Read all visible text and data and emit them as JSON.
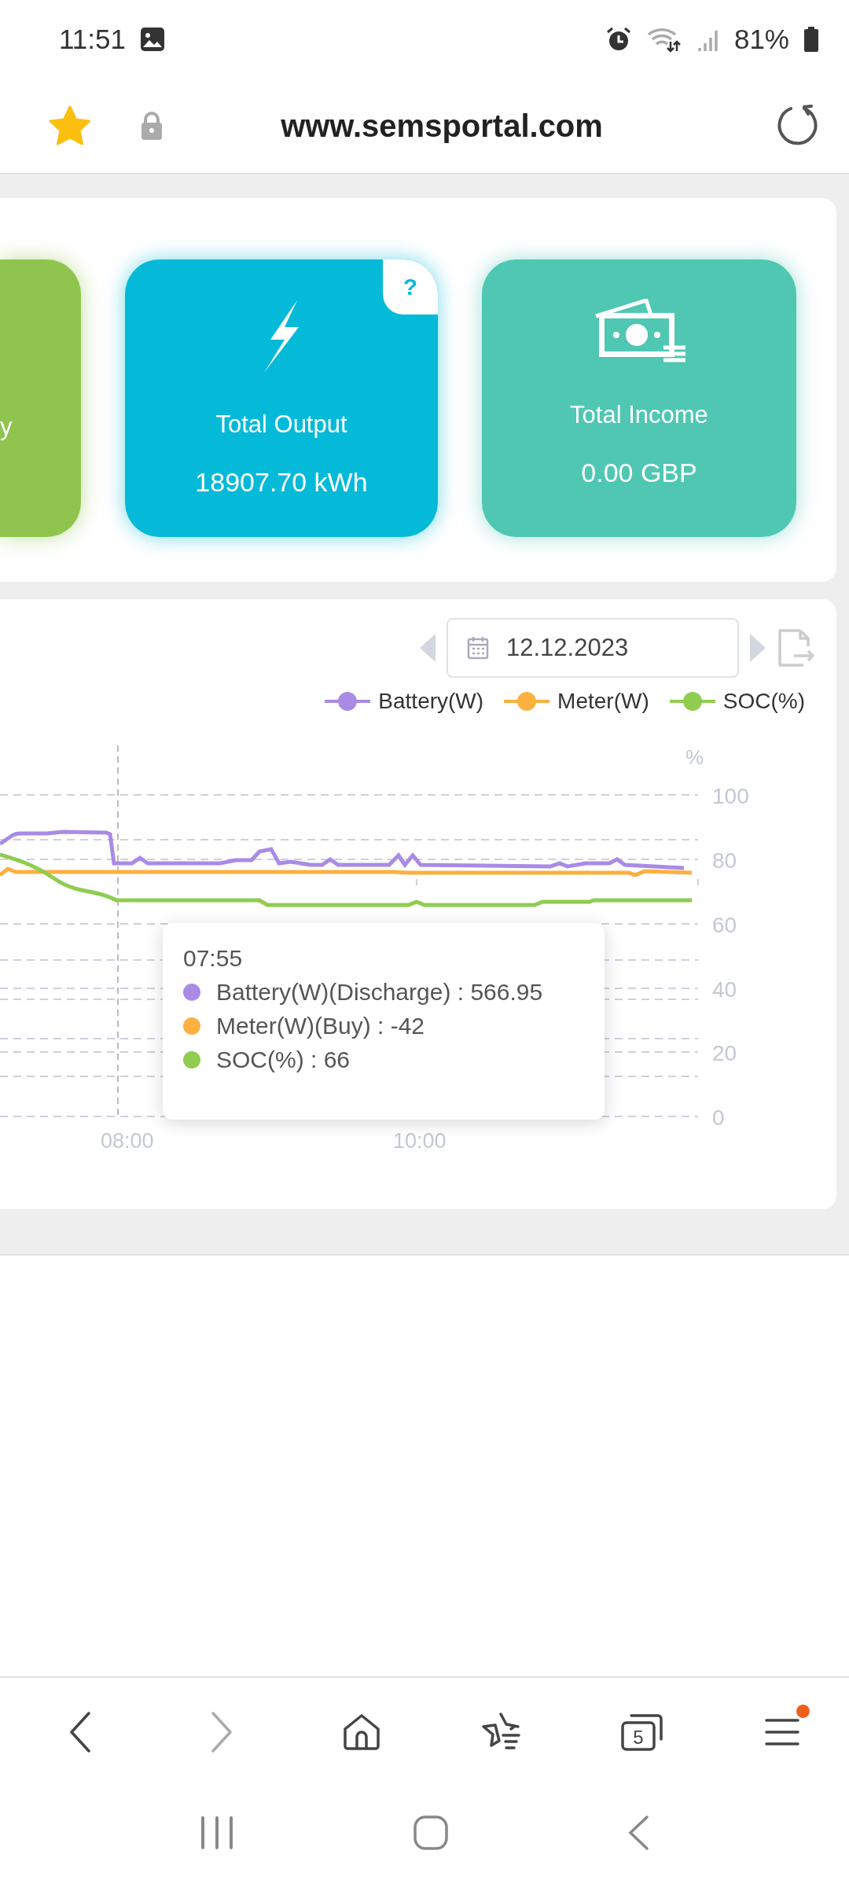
{
  "status_bar": {
    "time": "11:51",
    "battery_text": "81%"
  },
  "browser": {
    "url": "www.semsportal.com",
    "bookmarked": true
  },
  "summary_cards": [
    {
      "kind": "partial",
      "label": "y",
      "color": "#8fc44f"
    },
    {
      "kind": "output",
      "label": "Total Output",
      "value": "18907.70 kWh",
      "color": "#05bad8",
      "help": "?"
    },
    {
      "kind": "income",
      "label": "Total Income",
      "value": "0.00 GBP",
      "color": "#4fc7b3"
    }
  ],
  "chart": {
    "date": "12.12.2023",
    "legend": [
      {
        "name": "Battery(W)",
        "color": "#a98be6"
      },
      {
        "name": "Meter(W)",
        "color": "#fbb03f"
      },
      {
        "name": "SOC(%)",
        "color": "#8fcc50"
      }
    ],
    "y_unit": "%",
    "y_ticks": [
      "100",
      "80",
      "60",
      "40",
      "20",
      "0"
    ],
    "x_labels": [
      "08:00",
      "10:00"
    ],
    "tooltip": {
      "time": "07:55",
      "rows": [
        {
          "text": "Battery(W)(Discharge) : 566.95",
          "color": "#a98be6"
        },
        {
          "text": "Meter(W)(Buy) : -42",
          "color": "#fbb03f"
        },
        {
          "text": "SOC(%) : 66",
          "color": "#8fcc50"
        }
      ]
    }
  },
  "bottom_nav": [
    {
      "kind": "back",
      "disabled": false
    },
    {
      "kind": "forward",
      "disabled": true
    },
    {
      "kind": "home",
      "disabled": false
    },
    {
      "kind": "bookmarks",
      "disabled": false
    },
    {
      "kind": "tabs",
      "count": "5",
      "disabled": false
    },
    {
      "kind": "menu",
      "notification": true,
      "disabled": false
    }
  ]
}
